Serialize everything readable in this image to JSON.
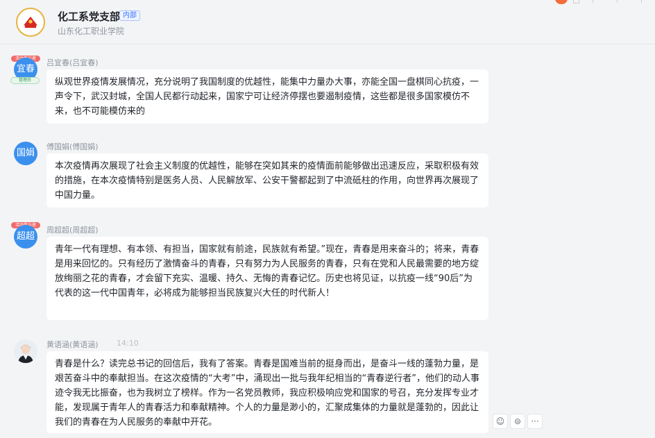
{
  "header": {
    "group_name": "化工系党支部",
    "internal_tag": "内部",
    "organization": "山东化工职业学院"
  },
  "messages": [
    {
      "avatar_text": "宜春",
      "badge_text": "活动参与者",
      "admin_tag": "管理员",
      "sender": "吕宜春(吕宜春)",
      "time": "",
      "text": "纵观世界疫情发展情况，充分说明了我国制度的优越性，能集中力量办大事，亦能全国一盘棋同心抗疫，一声令下，武汉封城，全国人民都行动起来，国家宁可让经济停摆也要遏制疫情，这些都是很多国家模仿不来，也不可能模仿来的"
    },
    {
      "avatar_text": "国娟",
      "sender": "傅国娟(傅国娟)",
      "time": "",
      "text": "本次疫情再次展现了社会主义制度的优越性，能够在突如其来的疫情面前能够做出迅速反应，采取积极有效的措施，在本次疫情特别是医务人员、人民解放军、公安干警都起到了中流砥柱的作用，向世界再次展现了中国力量。"
    },
    {
      "avatar_text": "超超",
      "badge_text": "活动参与者",
      "sender": "周超超(周超超)",
      "time": "",
      "text": "青年一代有理想、有本领、有担当，国家就有前途，民族就有希望。”现在，青春是用来奋斗的；将来，青春是用来回忆的。只有经历了激情奋斗的青春，只有努力为人民服务的青春，只有在党和人民最需要的地方绽放绚丽之花的青春，才会留下充实、温暖、持久、无悔的青春记忆。历史也将见证，以抗疫一线“90后”为代表的这一代中国青年，必将成为能够担当民族复兴大任的时代新人！"
    },
    {
      "sender": "黄语涵(黄语涵)",
      "time": "14:10",
      "text": "青春是什么？读完总书记的回信后，我有了答案。青春是国难当前的挺身而出，是奋斗一线的蓬勃力量，是艰苦奋斗中的奉献担当。在这次疫情的“大考”中，涌现出一批与我年纪相当的“青春逆行者”，他们的动人事迹令我无比振奋，也为我树立了榜样。作为一名党员教师，我应积极响应党和国家的号召，充分发挥专业才能，发现属于青年人的青春活力和奉献精神。个人的力量是渺小的，汇聚成集体的力量就是蓬勃的，因此让我们的青春在为人民服务的奉献中开花。"
    }
  ],
  "actions": [
    {
      "icon": "emoji-reaction-icon",
      "glyph": "☺"
    },
    {
      "icon": "reply-icon",
      "glyph": "⊜"
    },
    {
      "icon": "more-icon",
      "glyph": "···"
    }
  ],
  "colors": {
    "accent": "#3b90ee",
    "background": "#f3f4f6",
    "bubble": "#ffffff"
  }
}
